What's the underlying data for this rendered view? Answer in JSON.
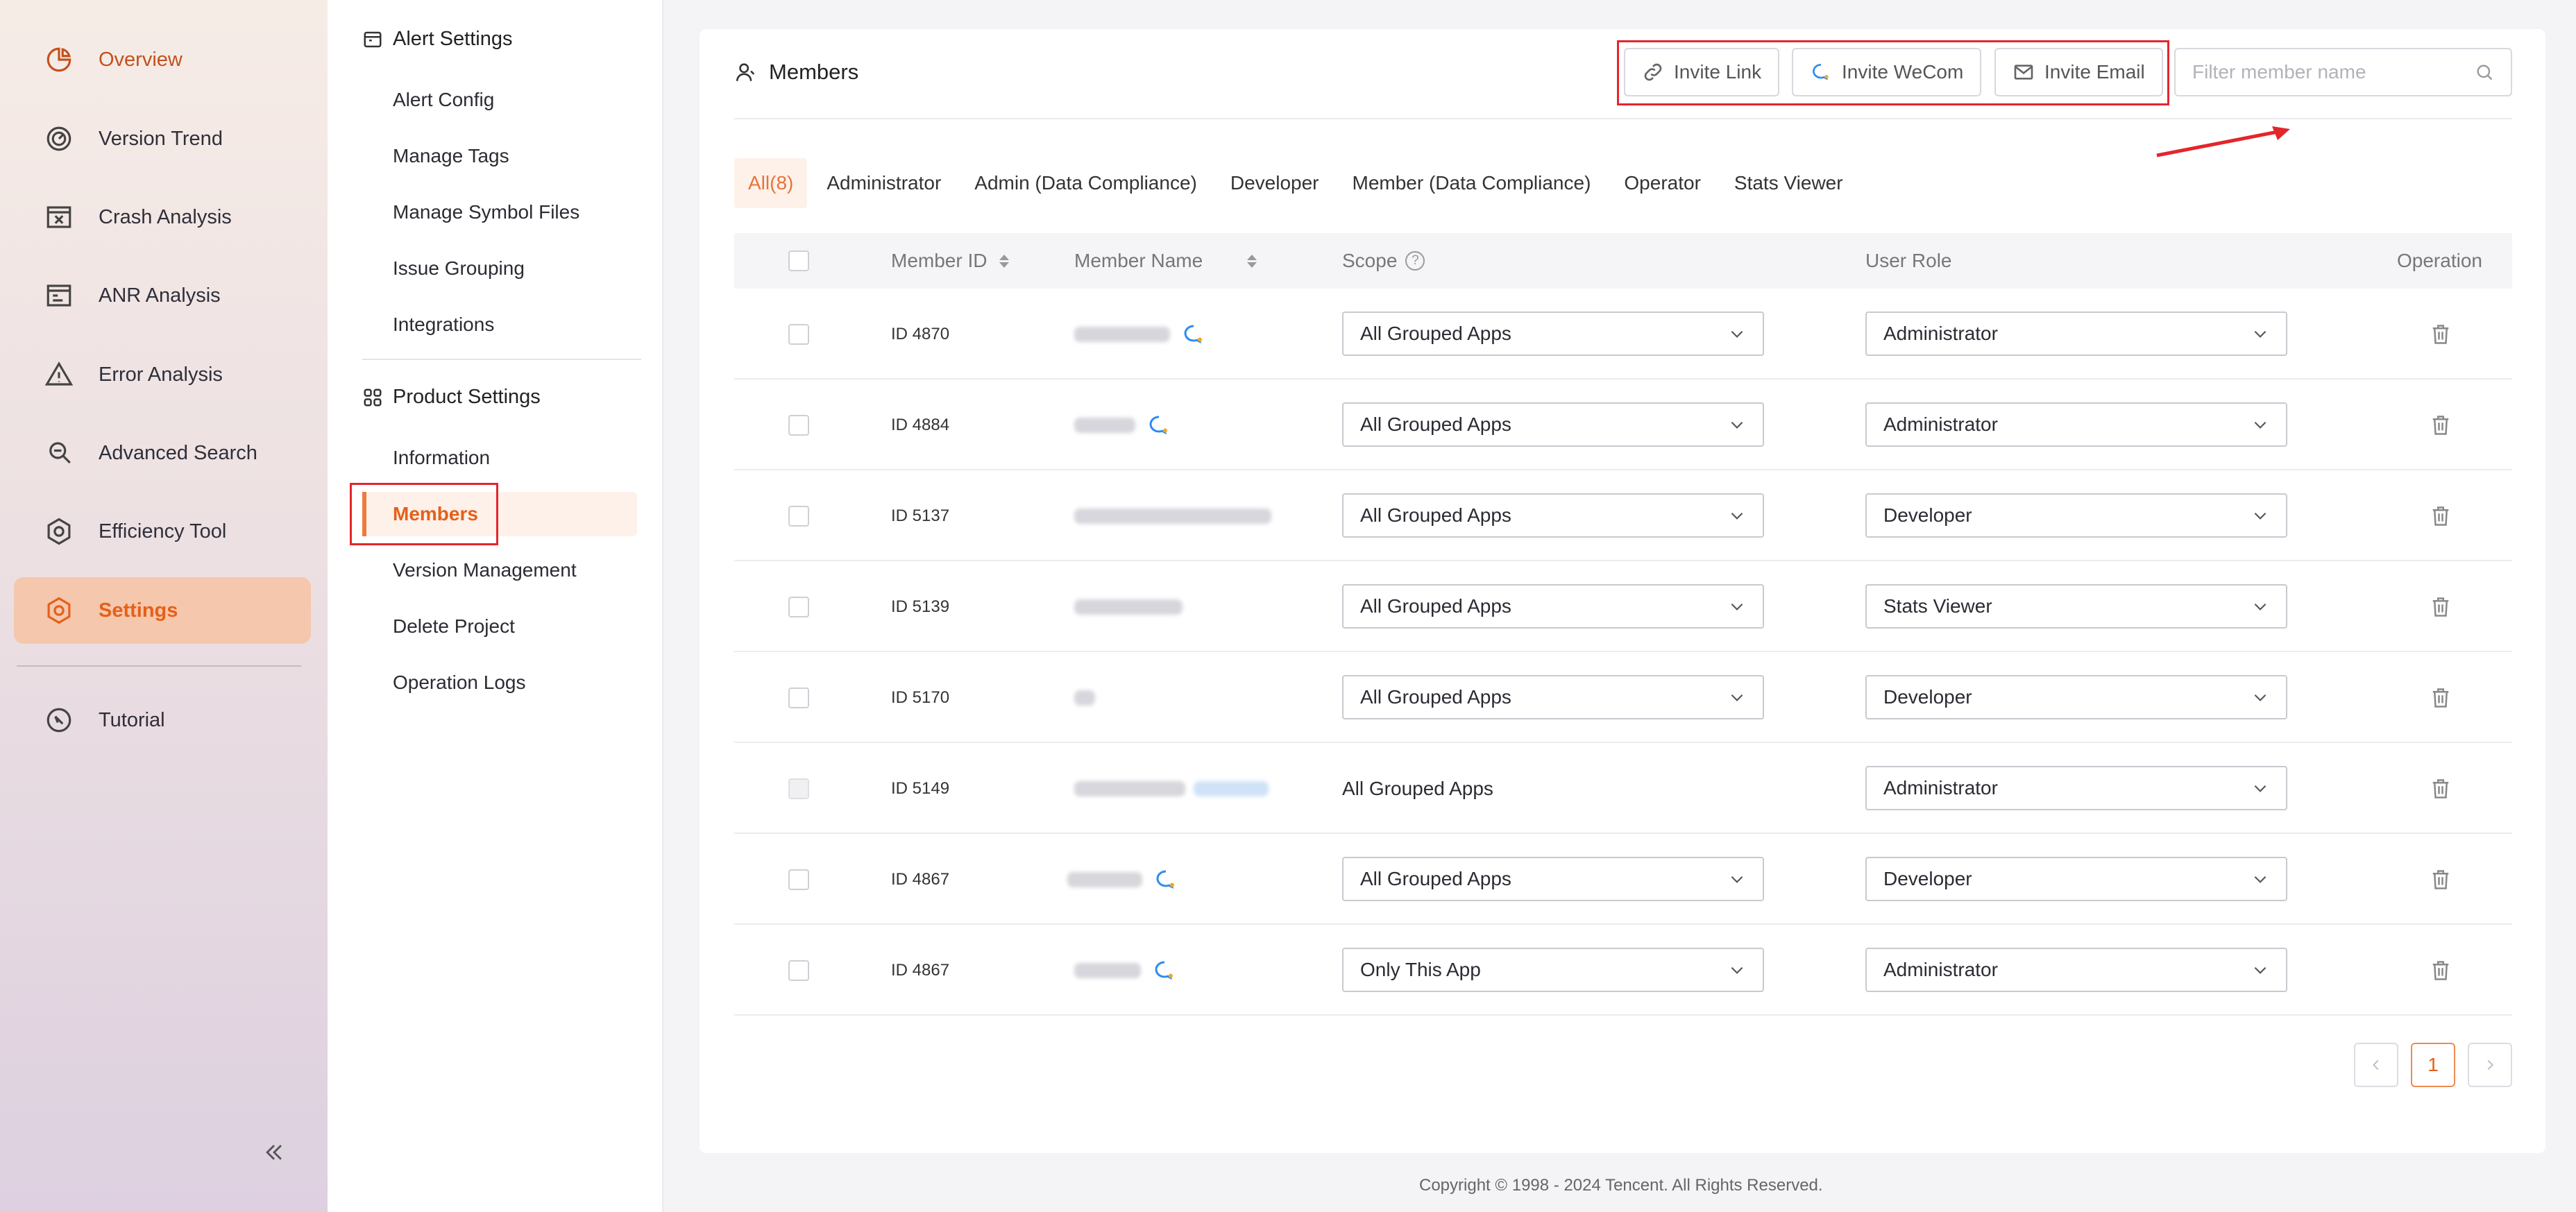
{
  "nav": {
    "items": [
      {
        "label": "Overview",
        "icon": "pie-chart-icon"
      },
      {
        "label": "Version Trend",
        "icon": "gauge-icon"
      },
      {
        "label": "Crash Analysis",
        "icon": "crash-window-icon"
      },
      {
        "label": "ANR Analysis",
        "icon": "anr-window-icon"
      },
      {
        "label": "Error Analysis",
        "icon": "warning-triangle-icon"
      },
      {
        "label": "Advanced Search",
        "icon": "search-doc-icon"
      },
      {
        "label": "Efficiency Tool",
        "icon": "gear-hex-icon"
      },
      {
        "label": "Settings",
        "icon": "settings-icon"
      },
      {
        "label": "Tutorial",
        "icon": "compass-icon"
      }
    ],
    "active": "Settings",
    "accent_color": "#e5601a"
  },
  "submenu": {
    "alert_heading": "Alert Settings",
    "alert_items": [
      "Alert Config",
      "Manage Tags",
      "Manage Symbol Files",
      "Issue Grouping",
      "Integrations"
    ],
    "product_heading": "Product Settings",
    "product_items": [
      "Information",
      "Members",
      "Version Management",
      "Delete Project",
      "Operation Logs"
    ],
    "active": "Members"
  },
  "members": {
    "title": "Members",
    "invite_link": "Invite Link",
    "invite_wecom": "Invite WeCom",
    "invite_email": "Invite Email",
    "search_placeholder": "Filter member name",
    "tabs": [
      "All(8)",
      "Administrator",
      "Admin (Data Compliance)",
      "Developer",
      "Member (Data Compliance)",
      "Operator",
      "Stats Viewer"
    ],
    "active_tab": "All(8)",
    "columns": {
      "member_id": "Member ID",
      "member_name": "Member Name",
      "scope": "Scope",
      "user_role": "User Role",
      "operation": "Operation"
    },
    "rows": [
      {
        "id": "ID 4870",
        "scope": "All Grouped Apps",
        "scope_editable": true,
        "role": "Administrator",
        "wecom": true
      },
      {
        "id": "ID 4884",
        "scope": "All Grouped Apps",
        "scope_editable": true,
        "role": "Administrator",
        "wecom": true
      },
      {
        "id": "ID 5137",
        "scope": "All Grouped Apps",
        "scope_editable": true,
        "role": "Developer",
        "wecom": false
      },
      {
        "id": "ID 5139",
        "scope": "All Grouped Apps",
        "scope_editable": true,
        "role": "Stats Viewer",
        "wecom": false
      },
      {
        "id": "ID 5170",
        "scope": "All Grouped Apps",
        "scope_editable": true,
        "role": "Developer",
        "wecom": false
      },
      {
        "id": "ID 5149",
        "scope": "All Grouped Apps",
        "scope_editable": false,
        "role": "Administrator",
        "wecom": false
      },
      {
        "id": "ID 4867",
        "scope": "All Grouped Apps",
        "scope_editable": true,
        "role": "Developer",
        "wecom": true
      },
      {
        "id": "ID 4867",
        "scope": "Only This App",
        "scope_editable": true,
        "role": "Administrator",
        "wecom": true
      }
    ],
    "pagination": {
      "current": "1"
    }
  },
  "footer": {
    "copyright": "Copyright © 1998 - 2024 Tencent. All Rights Reserved."
  }
}
